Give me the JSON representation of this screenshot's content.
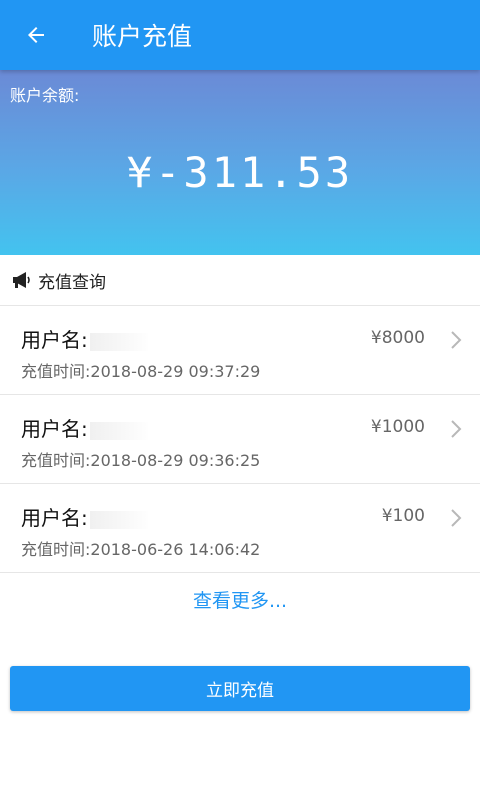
{
  "appbar": {
    "title": "账户充值",
    "back_icon": "arrow-left-icon"
  },
  "balance": {
    "label": "账户余额:",
    "amount": "¥-311.53"
  },
  "section": {
    "icon": "megaphone-icon",
    "title": "充值查询"
  },
  "records": [
    {
      "username_label": "用户名:",
      "amount": "¥8000",
      "time": "充值时间:2018-08-29 09:37:29"
    },
    {
      "username_label": "用户名:",
      "amount": "¥1000",
      "time": "充值时间:2018-08-29 09:36:25"
    },
    {
      "username_label": "用户名:",
      "amount": "¥100",
      "time": "充值时间:2018-06-26 14:06:42"
    }
  ],
  "more_label": "查看更多...",
  "recharge_button": "立即充值",
  "colors": {
    "primary": "#2196f3",
    "gradient_top": "#6b8ad6",
    "gradient_bottom": "#43c3ef"
  }
}
